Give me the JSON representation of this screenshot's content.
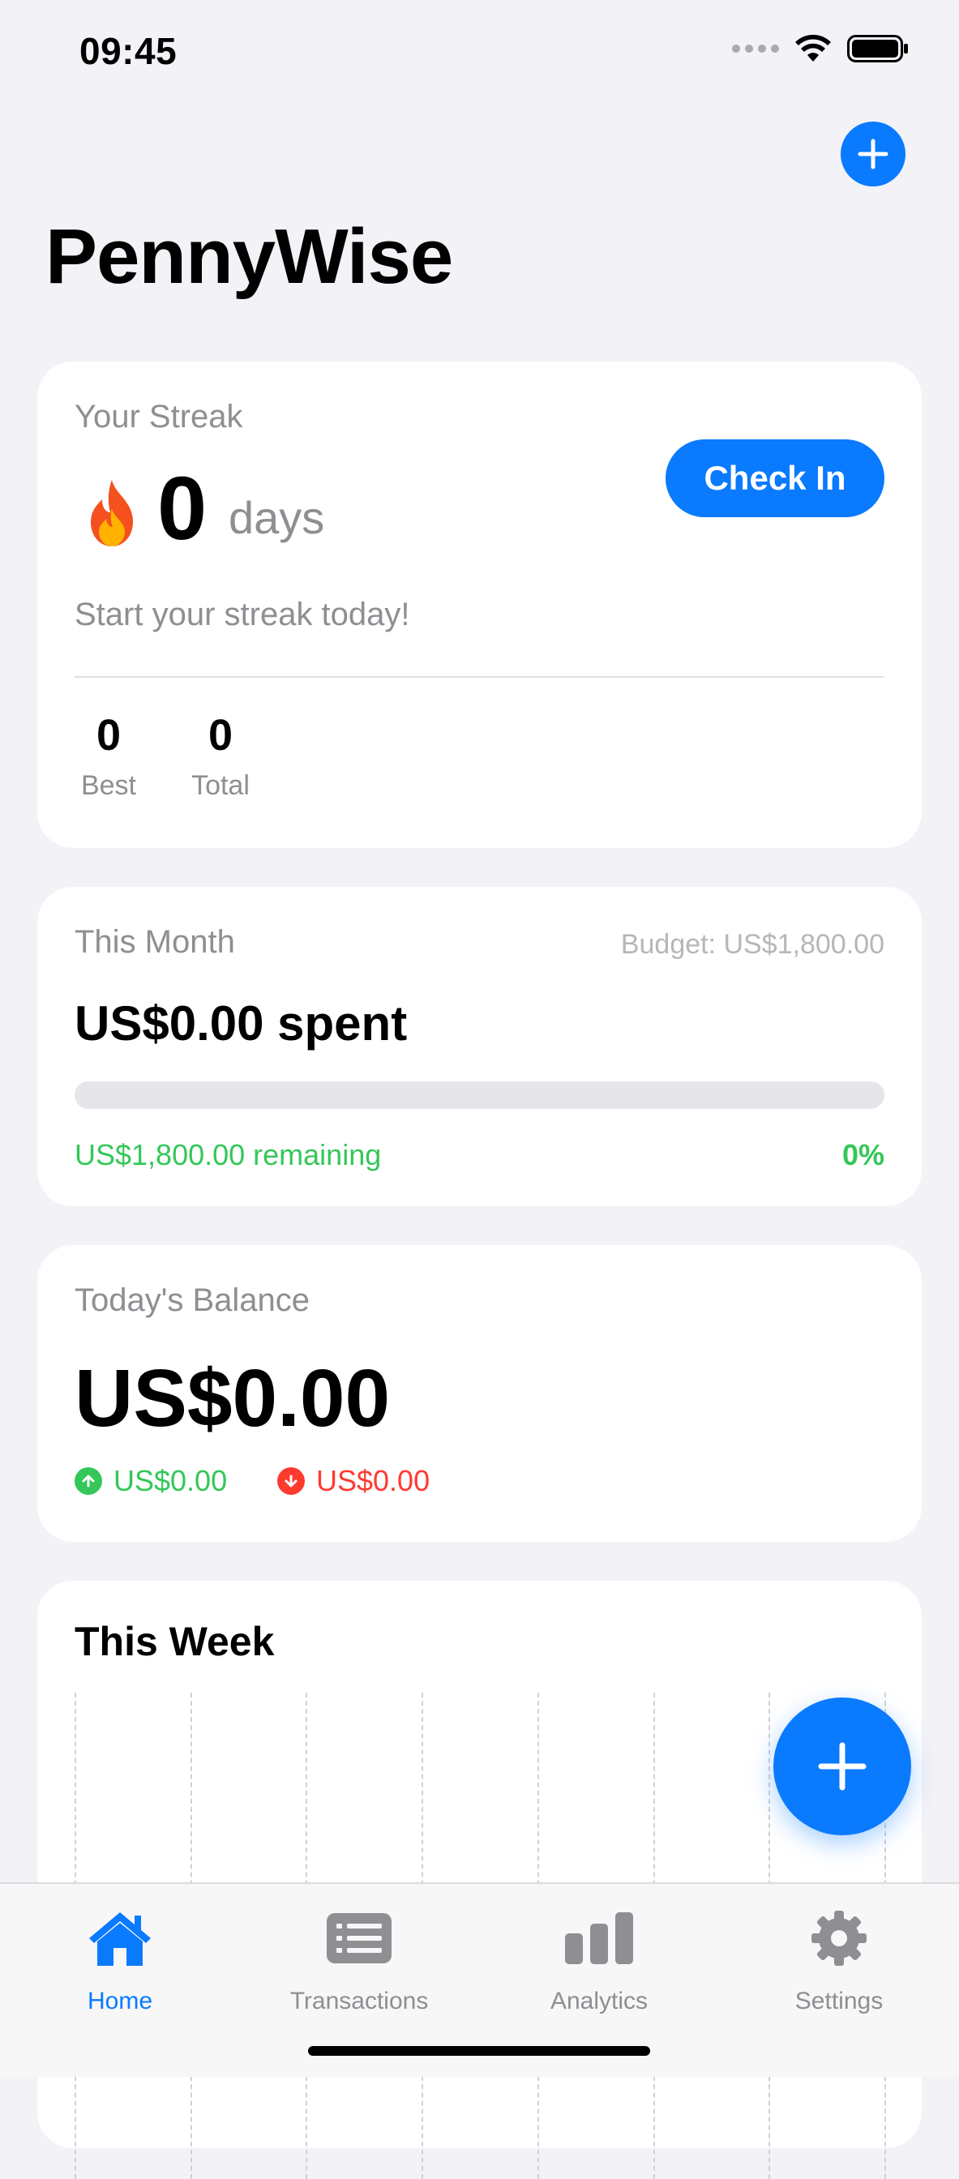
{
  "status_bar": {
    "time": "09:45"
  },
  "app": {
    "title": "PennyWise"
  },
  "streak": {
    "label": "Your Streak",
    "count": "0",
    "unit": "days",
    "check_in_label": "Check In",
    "message": "Start your streak today!",
    "best_value": "0",
    "best_label": "Best",
    "total_value": "0",
    "total_label": "Total"
  },
  "month": {
    "label": "This Month",
    "budget": "Budget: US$1,800.00",
    "spent": "US$0.00 spent",
    "progress_fraction": 0,
    "remaining": "US$1,800.00 remaining",
    "percent": "0%"
  },
  "balance": {
    "label": "Today's Balance",
    "amount": "US$0.00",
    "income": "US$0.00",
    "expense": "US$0.00"
  },
  "week": {
    "title": "This Week"
  },
  "tabs": [
    {
      "label": "Home",
      "icon": "house-icon",
      "active": true
    },
    {
      "label": "Transactions",
      "icon": "list-icon",
      "active": false
    },
    {
      "label": "Analytics",
      "icon": "bar-chart-icon",
      "active": false
    },
    {
      "label": "Settings",
      "icon": "gear-icon",
      "active": false
    }
  ],
  "colors": {
    "accent": "#0A7AFF",
    "positive": "#34C759",
    "negative": "#FF3B30",
    "background": "#F2F2F7"
  }
}
